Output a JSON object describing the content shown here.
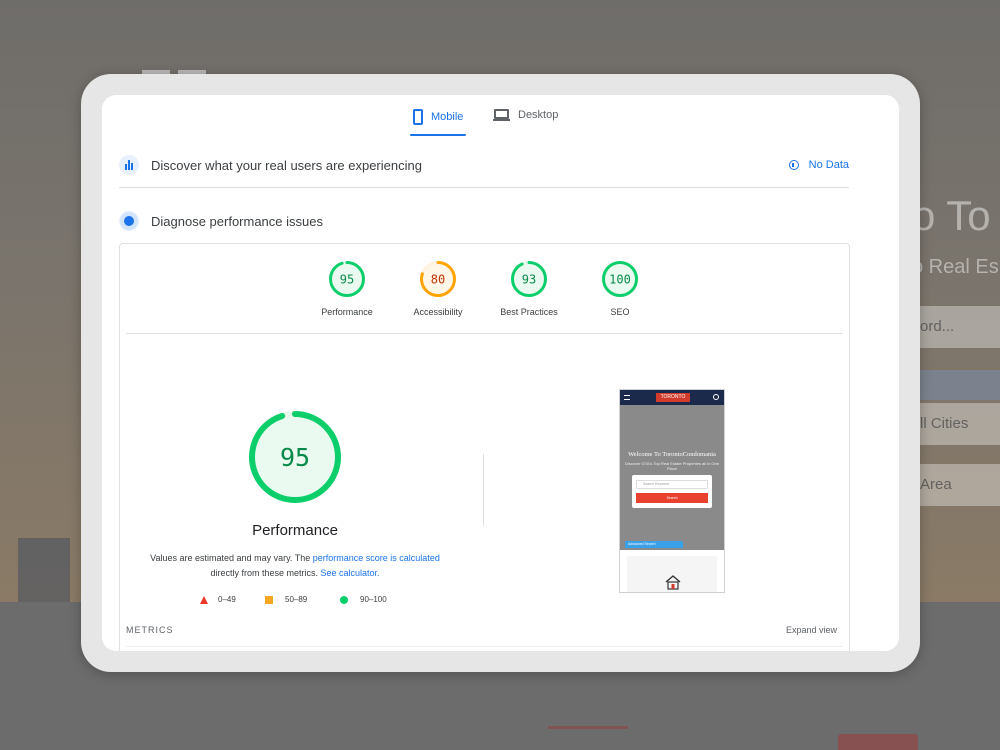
{
  "background": {
    "hero_title": "o To",
    "hero_subtitle": "o Real Es",
    "field_1": "ord...",
    "field_2": "ll Cities",
    "field_3": "Area"
  },
  "tabs": [
    {
      "label": "Mobile",
      "icon": "smartphone-icon",
      "active": true
    },
    {
      "label": "Desktop",
      "icon": "laptop-icon",
      "active": false
    }
  ],
  "field_data": {
    "title": "Discover what your real users are experiencing",
    "status": "No Data",
    "status_icon": "info-icon"
  },
  "lab_data": {
    "title": "Diagnose performance issues"
  },
  "scores": [
    {
      "value": 95,
      "label": "Performance",
      "color": "#0cce6b",
      "track": "#e6f7ec",
      "fill": "#eafaf0",
      "text_color": "#0a8a4a"
    },
    {
      "value": 80,
      "label": "Accessibility",
      "color": "#ffa400",
      "track": "#fff3e0",
      "fill": "#fff6e8",
      "text_color": "#c33300"
    },
    {
      "value": 93,
      "label": "Best Practices",
      "color": "#0cce6b",
      "track": "#e6f7ec",
      "fill": "#eafaf0",
      "text_color": "#0a8a4a"
    },
    {
      "value": 100,
      "label": "SEO",
      "color": "#0cce6b",
      "track": "#e6f7ec",
      "fill": "#eafaf0",
      "text_color": "#0a8a4a"
    }
  ],
  "performance": {
    "score": 95,
    "label": "Performance",
    "desc_pre": "Values are estimated and may vary. The ",
    "desc_link": "performance score is calculated",
    "desc_mid": "directly from these metrics. ",
    "desc_link2": "See calculator."
  },
  "legend": [
    {
      "range": "0–49",
      "shape": "triangle",
      "color": "#e8382c"
    },
    {
      "range": "50–89",
      "shape": "square",
      "color": "#f5a623"
    },
    {
      "range": "90–100",
      "shape": "circle",
      "color": "#0cce6b"
    }
  ],
  "thumbnail": {
    "logo": "TORONTO",
    "heading": "Welcome To TorontoCondomania",
    "subheading": "Discover GTA's Top Real Estate Properties all in One Place",
    "search_placeholder": "Search Keyword",
    "search_button": "Search",
    "advanced": "Advanced Search"
  },
  "metrics": {
    "label": "METRICS",
    "expand": "Expand view"
  }
}
